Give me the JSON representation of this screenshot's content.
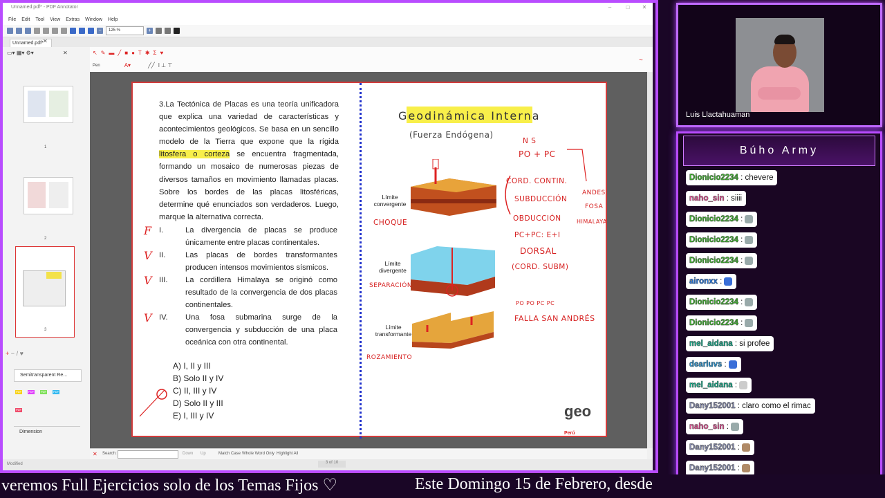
{
  "window": {
    "title": "Unnamed.pdf* - PDF Annotator",
    "menu": [
      "File",
      "Edit",
      "Tool",
      "View",
      "Extras",
      "Window",
      "Help"
    ],
    "zoom": "125 %",
    "doc_tab": "Unnamed.pdf*"
  },
  "toolbar2": {
    "pen_label": "Pen"
  },
  "sidebar": {
    "pages": [
      "1",
      "2",
      "3"
    ],
    "properties": [
      {
        "label": "Semitransparent Re..."
      },
      {
        "label": "Dimension"
      }
    ],
    "swatches": [
      {
        "label": "PDF",
        "color": "#f7d21a"
      },
      {
        "label": "PDF",
        "color": "#e040fb"
      },
      {
        "label": "PDF",
        "color": "#7fe05a"
      },
      {
        "label": "PDF",
        "color": "#34b9f0"
      },
      {
        "label": "PDF",
        "color": "#ef4b6a"
      }
    ]
  },
  "question": {
    "part1": "3.La Tectónica de Placas es una teoría unificadora que explica una variedad de características y acontecimientos geológicos. Se basa en un sencillo modelo de la Tierra que expone que la rígida",
    "highlight": "litosfera o corteza",
    "part2": "se encuentra fragmentada, formando un mosaico de numerosas piezas de diversos tamaños en movimiento llamadas placas. Sobre los bordes de las placas litosféricas, determine qué enunciados son verdaderos. Luego, marque la alternativa correcta.",
    "items": [
      {
        "num": "I.",
        "text": "La divergencia de placas se produce únicamente entre placas continentales.",
        "mark": "F"
      },
      {
        "num": "II.",
        "text": "Las placas de bordes transformantes producen intensos movimientos sísmicos.",
        "mark": "V"
      },
      {
        "num": "III.",
        "text": "La cordillera Himalaya se originó como resultado de la convergencia de dos placas continentales.",
        "mark": "V"
      },
      {
        "num": "IV.",
        "text": "Una fosa submarina surge de la convergencia y subducción de una placa oceánica con otra continental.",
        "mark": "V"
      }
    ],
    "options": [
      "A)  I, II y III",
      "B)  Solo II y IV",
      "C)  II, III y IV",
      "D)  Solo II y III",
      "E)  I, III y IV"
    ]
  },
  "diagram": {
    "title": "Geodinámica Interna",
    "subtitle": "(Fuerza Endógena)",
    "labels": {
      "convergente": [
        "Límite",
        "convergente"
      ],
      "divergente": [
        "Límite",
        "divergente"
      ],
      "transformante": [
        "Límite",
        "transformante"
      ]
    },
    "notes": {
      "ns": "N   S",
      "pd_pc": "PO + PC",
      "cord_contin": "CORD. CONTIN.",
      "subduccion": "SUBDUCCIÓN",
      "andes": "ANDES",
      "fosa": "FOSA",
      "obduccion": "OBDUCCIÓN",
      "himalaya": "HIMALAYA",
      "pcpc": "PC+PC: E+I",
      "choque": "CHOQUE",
      "dorsal": "DORSAL",
      "cord_subm": "(CORD. SUBM)",
      "separacion": "SEPARACIÓN",
      "po_pc": "PO   PO     PC   PC",
      "falla": "FALLA SAN ANDRÉS",
      "rozamiento": "ROZAMIENTO"
    },
    "logo": "geo",
    "logo_sub": "Perú"
  },
  "search": {
    "label": "Search:",
    "down": "Down",
    "up": "Up",
    "match_case": "Match Case",
    "whole_word": "Whole Word Only",
    "highlight_all": "Highlight All"
  },
  "status": {
    "left": "Modified",
    "page": "3 of 10"
  },
  "webcam": {
    "name": "Luis Llactahuaman"
  },
  "chat": {
    "title": "Búho Army",
    "messages": [
      {
        "user": "Dionicio2234",
        "text": ": chevere",
        "color": "#45b236",
        "emote": ""
      },
      {
        "user": "naho_sin",
        "text": ": siiii",
        "color": "#e8589b",
        "emote": ""
      },
      {
        "user": "Dionicio2234",
        "text": ":",
        "color": "#45b236",
        "emote": "#9aa"
      },
      {
        "user": "Dionicio2234",
        "text": ":",
        "color": "#45b236",
        "emote": "#9aa"
      },
      {
        "user": "Dionicio2234",
        "text": ":",
        "color": "#45b236",
        "emote": "#9aa"
      },
      {
        "user": "aironxx",
        "text": ":",
        "color": "#2f7de3",
        "emote": "#3a6fd8"
      },
      {
        "user": "Dionicio2234",
        "text": ":",
        "color": "#45b236",
        "emote": "#9aa"
      },
      {
        "user": "Dionicio2234",
        "text": ":",
        "color": "#45b236",
        "emote": "#9aa"
      },
      {
        "user": "mel_aidana",
        "text": ": si profee",
        "color": "#1fb090",
        "emote": ""
      },
      {
        "user": "dearluvs",
        "text": ":",
        "color": "#2f9ad6",
        "emote": "#3a6fd8"
      },
      {
        "user": "mel_aidana",
        "text": ":",
        "color": "#1fb090",
        "emote": "#ccc"
      },
      {
        "user": "Dany152001",
        "text": ": claro como el rimac",
        "color": "#8a8fb0",
        "emote": ""
      },
      {
        "user": "naho_sin",
        "text": ":",
        "color": "#e8589b",
        "emote": "#9aa"
      },
      {
        "user": "Dany152001",
        "text": ":",
        "color": "#8a8fb0",
        "emote": "#b08a66"
      },
      {
        "user": "Dany152001",
        "text": ":",
        "color": "#8a8fb0",
        "emote": "#b08a66"
      }
    ]
  },
  "ticker": {
    "left": "veremos Full Ejercicios solo de los Temas Fijos ♡",
    "right": "Este Domingo 15 de Febrero, desde"
  }
}
